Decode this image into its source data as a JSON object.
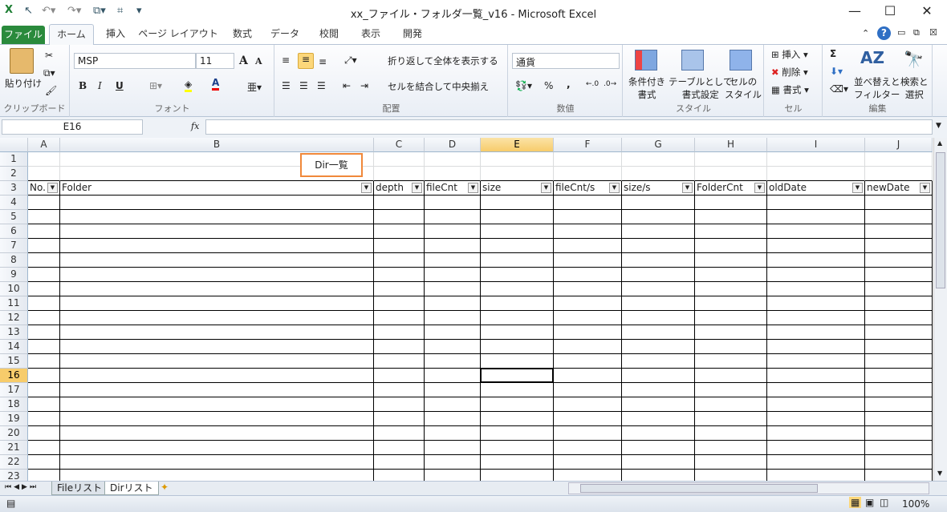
{
  "window": {
    "title": "xx_ファイル・フォルダ一覧_v16  -  Microsoft Excel",
    "minimize": "—",
    "maximize": "☐",
    "close": "✕"
  },
  "tabs": [
    "ファイル",
    "ホーム",
    "挿入",
    "ページ レイアウト",
    "数式",
    "データ",
    "校閲",
    "表示",
    "開発"
  ],
  "ribbon": {
    "clipboard": {
      "paste": "貼り付け",
      "label": "クリップボード"
    },
    "font": {
      "name": "MSP",
      "size": "11",
      "bold": "B",
      "italic": "I",
      "underline": "U",
      "grow": "A",
      "shrink": "A",
      "label": "フォント"
    },
    "alignment": {
      "wrap": "折り返して全体を表示する",
      "merge": "セルを結合して中央揃え",
      "label": "配置"
    },
    "number": {
      "format": "通貨",
      "percent": "%",
      "comma": ",",
      "label": "数値"
    },
    "styles": {
      "conditional": "条件付き\n書式",
      "table": "テーブルとして\n書式設定",
      "cellstyle": "セルの\nスタイル",
      "label": "スタイル"
    },
    "cells": {
      "insert": "挿入",
      "delete": "削除",
      "format": "書式",
      "label": "セル"
    },
    "editing": {
      "sum": "Σ",
      "sort": "並べ替えと\nフィルター",
      "find": "検索と\n選択",
      "label": "編集"
    }
  },
  "formula_bar": {
    "name_box": "E16",
    "fx": "fx",
    "value": ""
  },
  "columns": [
    "A",
    "B",
    "C",
    "D",
    "E",
    "F",
    "G",
    "H",
    "I",
    "J"
  ],
  "selected_column": "E",
  "selected_row": 16,
  "rows": 23,
  "title_cell": "Dir一覧",
  "headers": [
    "No.",
    "Folder",
    "depth",
    "fileCnt",
    "size",
    "fileCnt/s",
    "size/s",
    "FolderCnt",
    "oldDate",
    "newDate"
  ],
  "sheets": [
    "Fileリスト",
    "Dirリスト"
  ],
  "active_sheet": "Dirリスト",
  "status": {
    "zoom": "100%"
  }
}
